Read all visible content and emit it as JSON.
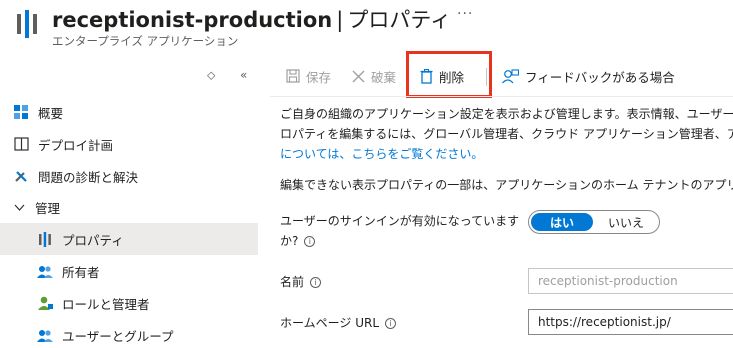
{
  "header": {
    "resource_name": "receptionist-production",
    "separator": "|",
    "page_name": "プロパティ",
    "more": "···",
    "subtitle": "エンタープライズ アプリケーション"
  },
  "sidebar": {
    "collapse_up_glyph": "⬦",
    "collapse_left_glyph": "«",
    "items": [
      {
        "label": "概要",
        "icon": "overview-grid-icon"
      },
      {
        "label": "デプロイ計画",
        "icon": "book-icon"
      },
      {
        "label": "問題の診断と解決",
        "icon": "wrench-icon"
      },
      {
        "label": "管理",
        "icon": "chevron-down-icon"
      },
      {
        "label": "プロパティ",
        "icon": "properties-bars-icon",
        "selected": true
      },
      {
        "label": "所有者",
        "icon": "people-icon"
      },
      {
        "label": "ロールと管理者",
        "icon": "role-person-icon"
      },
      {
        "label": "ユーザーとグループ",
        "icon": "users-groups-icon"
      }
    ]
  },
  "toolbar": {
    "save_label": "保存",
    "discard_label": "破棄",
    "delete_label": "削除",
    "feedback_label": "フィードバックがある場合"
  },
  "content": {
    "intro_line1": "ご自身の組織のアプリケーション設定を表示および管理します。表示情報、ユーザー",
    "intro_line2": "ロパティを編集するには、グローバル管理者、クラウド アプリケーション管理者、アプリ",
    "intro_link": "については、こちらをご覧ください。",
    "note": "編集できない表示プロパティの一部は、アプリケーションのホーム テナントのアプリケ",
    "signin_label_line1": "ユーザーのサインインが有効になっています",
    "signin_label_line2": "か?",
    "toggle_on": "はい",
    "toggle_off": "いいえ",
    "name_label": "名前",
    "name_value": "receptionist-production",
    "homepage_label": "ホームページ URL",
    "homepage_value": "https://receptionist.jp/"
  },
  "colors": {
    "accent": "#0078d4",
    "highlight": "#e8341c",
    "selected_bg": "#edebe9"
  }
}
